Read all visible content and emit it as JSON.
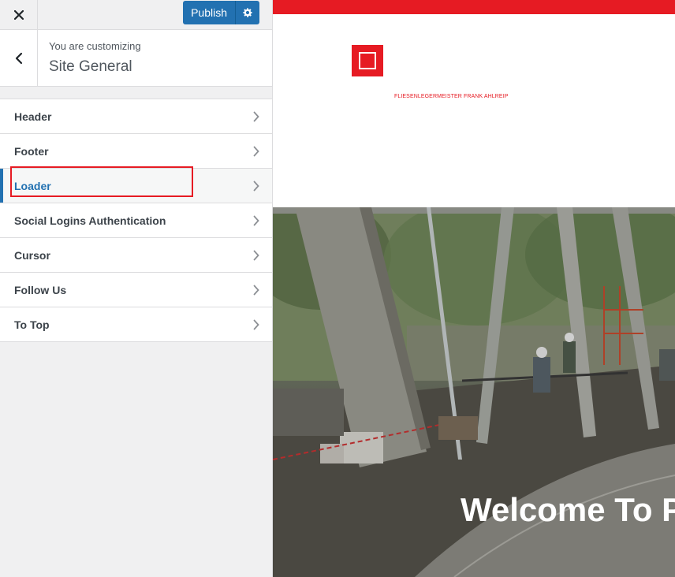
{
  "toolbar": {
    "close_icon": "close-icon",
    "publish_label": "Publish",
    "settings_icon": "gear-icon"
  },
  "section": {
    "back_icon": "chevron-left-icon",
    "subtitle": "You are customizing",
    "title": "Site General"
  },
  "menu": {
    "items": [
      {
        "label": "Header"
      },
      {
        "label": "Footer"
      },
      {
        "label": "Loader",
        "active": true
      },
      {
        "label": "Social Logins Authentication"
      },
      {
        "label": "Cursor"
      },
      {
        "label": "Follow Us"
      },
      {
        "label": "To Top"
      }
    ]
  },
  "preview": {
    "tagline": "FLIESENLEGERMEISTER FRANK AHLREIP",
    "hero_title": "Welcome To P",
    "colors": {
      "brand": "#e61b23",
      "accent": "#2271b1"
    }
  }
}
